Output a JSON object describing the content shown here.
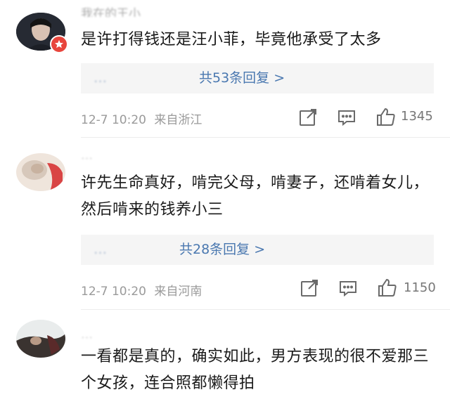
{
  "comments": [
    {
      "author": "我在的王小",
      "text": "是许打得钱还是汪小菲，毕竟他承受了太多",
      "reply_names": "…",
      "reply_count": "共53条回复 >",
      "time": "12-7 10:20",
      "location": "来自浙江",
      "likes": "1345"
    },
    {
      "author": "…",
      "text": "许先生命真好，啃完父母，啃妻子，还啃着女儿，然后啃来的钱养小三",
      "reply_names": "…",
      "reply_count": "共28条回复 >",
      "time": "12-7 10:20",
      "location": "来自河南",
      "likes": "1150"
    },
    {
      "author": "…",
      "text": "一看都是真的，确实如此，男方表现的很不爱那三个女孩，连合照都懒得拍"
    }
  ],
  "colors": {
    "link": "#4a78b0",
    "meta": "#9a9a9a",
    "reply_bg": "#f5f5f5",
    "badge": "#e8453c"
  },
  "icons": [
    "share-icon",
    "comment-icon",
    "like-icon",
    "verified-badge-icon"
  ]
}
